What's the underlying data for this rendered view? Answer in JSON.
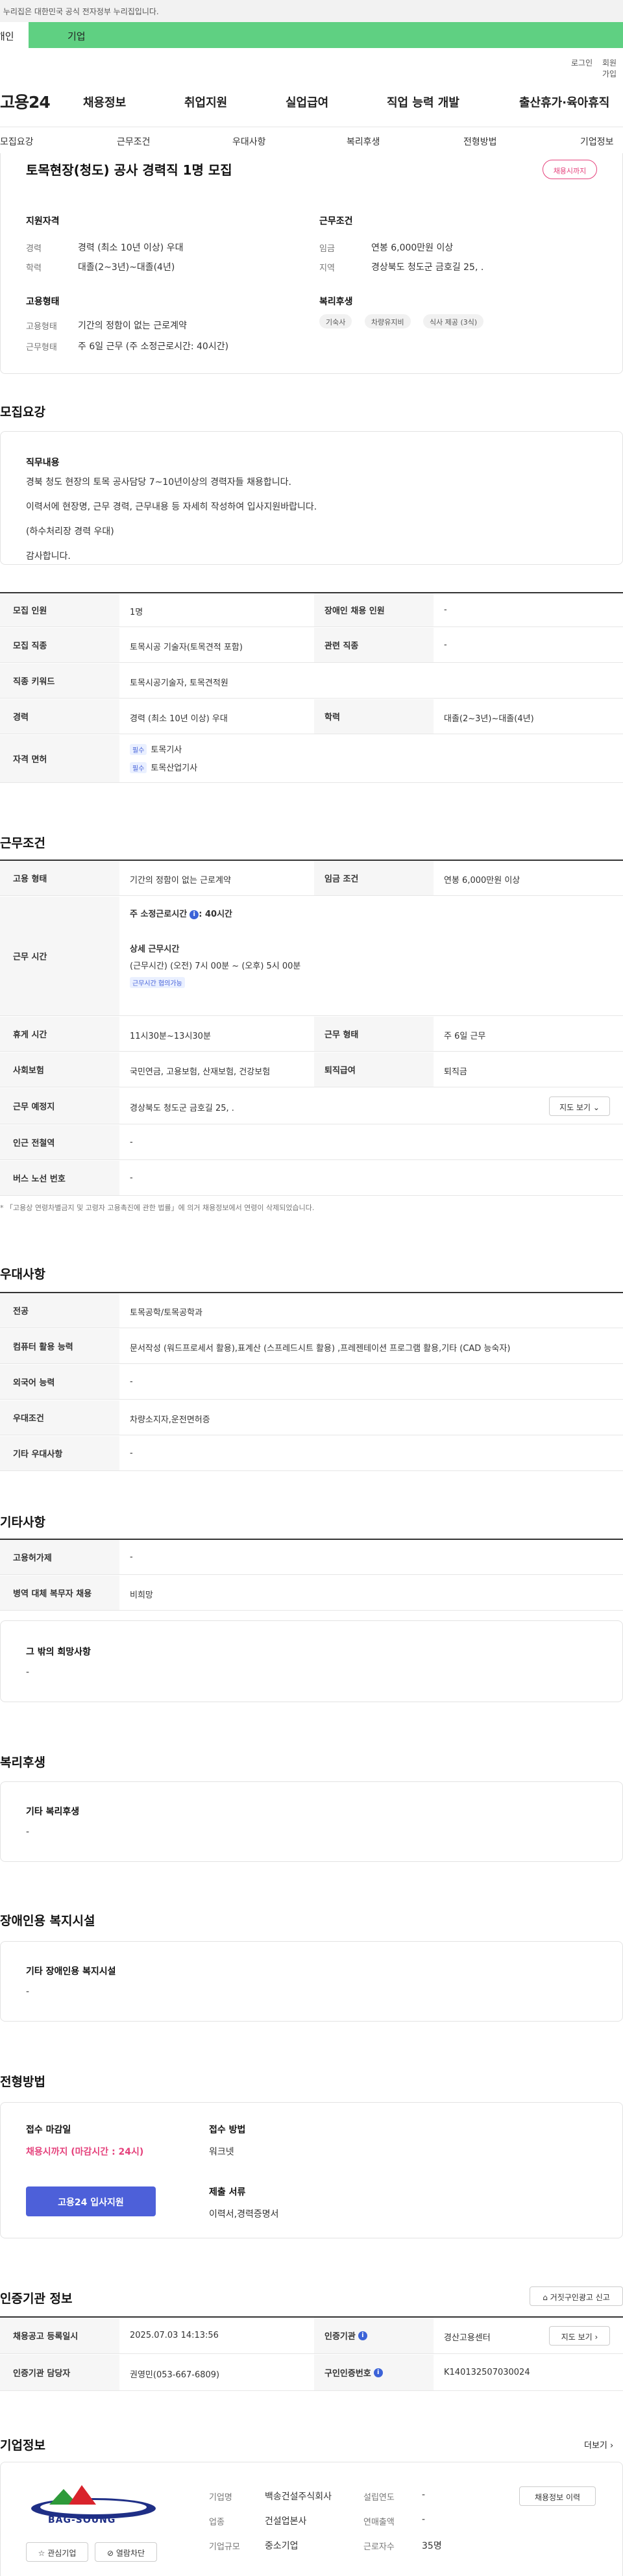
{
  "gov_banner": "이 누리집은 대한민국 공식 전자정부 누리집입니다.",
  "user_tabs": [
    "개인",
    "기업"
  ],
  "util_links": [
    "로그인",
    "회원가입"
  ],
  "logo": "고용24",
  "gnb": [
    "채용정보",
    "취업지원",
    "실업급여",
    "직업 능력 개발",
    "출산휴가·육아휴직"
  ],
  "anchor_nav": [
    "모집요강",
    "근무조건",
    "우대사항",
    "복리후생",
    "전형방법",
    "기업정보"
  ],
  "summary": {
    "title": "토목현장(청도) 공사 경력직 1명 모집",
    "badge": "채용시까지",
    "qualification_head": "지원자격",
    "career_label": "경력",
    "career": "경력 (최소 10년 이상) 우대",
    "edu_label": "학력",
    "edu": "대졸(2~3년)~대졸(4년)",
    "conditions_head": "근무조건",
    "wage_label": "임금",
    "wage": "연봉 6,000만원 이상",
    "region_label": "지역",
    "region": "경상북도 청도군 금호길 25, .",
    "employment_head": "고용형태",
    "emp_type_label": "고용형태",
    "emp_type": "기간의 정함이 없는 근로계약",
    "work_type_label": "근무형태",
    "work_type": "주 6일 근무 (주 소정근로시간: 40시간)",
    "welfare_head": "복리후생",
    "welfare_chips": [
      "기숙사",
      "차량유지비",
      "식사 제공 (3식)"
    ]
  },
  "recruit": {
    "title": "모집요강",
    "duties_title": "직무내용",
    "duties": [
      "경북 청도 현장의 토목 공사담당 7~10년이상의 경력자들 채용합니다.",
      "이력서에 현장명, 근무 경력, 근무내용 등 자세히 작성하여 입사지원바랍니다.",
      "(하수처리장 경력 우대)",
      "감사합니다."
    ],
    "rows": {
      "count_label": "모집 인원",
      "count": "1명",
      "disabled_label": "장애인 채용 인원",
      "disabled": "-",
      "job_label": "모집 직종",
      "job": "토목시공 기술자(토목견적 포함)",
      "related_label": "관련 직종",
      "related": "-",
      "keyword_label": "직종 키워드",
      "keyword": "토목시공기술자, 토목견적원",
      "career_label": "경력",
      "career": "경력 (최소 10년 이상) 우대",
      "edu_label": "학력",
      "edu": "대졸(2~3년)~대졸(4년)",
      "license_label": "자격 면허",
      "license_tag": "필수",
      "licenses": [
        "토목기사",
        "토목산업기사"
      ]
    }
  },
  "conditions": {
    "title": "근무조건",
    "emp_label": "고용 형태",
    "emp": "기간의 정함이 없는 근로계약",
    "wage_label": "임금 조건",
    "wage": "연봉 6,000만원 이상",
    "hours_label": "근무 시간",
    "hours_week_label": "주 소정근로시간",
    "hours_week": ": 40시간",
    "hours_detail_label": "상세 근무시간",
    "hours_detail": "(근무시간) (오전) 7시 00분 ~ (오후) 5시 00분",
    "hours_tag": "근무시간 협의가능",
    "break_label": "휴게 시간",
    "break": "11시30분~13시30분",
    "worktype_label": "근무 형태",
    "worktype": "주 6일 근무",
    "insurance_label": "사회보험",
    "insurance": "국민연금, 고용보험, 산재보험, 건강보험",
    "retire_label": "퇴직급여",
    "retire": "퇴직금",
    "place_label": "근무 예정지",
    "place": "경상북도 청도군 금호길 25, .",
    "map_btn": "지도 보기",
    "subway_label": "인근 전철역",
    "subway": "-",
    "bus_label": "버스 노선 번호",
    "bus": "-",
    "note": "* 「고용상 연령차별금지 및 고령자 고용촉진에 관한 법률」에 의거 채용정보에서 연령이 삭제되었습니다."
  },
  "preference": {
    "title": "우대사항",
    "major_label": "전공",
    "major": "토목공학/토목공학과",
    "computer_label": "컴퓨터 활용 능력",
    "computer": "문서작성 (워드프로세서 활용),표계산 (스프레드시트 활용) ,프레젠테이션 프로그램 활용,기타 (CAD 능숙자)",
    "lang_label": "외국어 능력",
    "lang": "-",
    "cond_label": "우대조건",
    "cond": "차량소지자,운전면허증",
    "etc_label": "기타 우대사항",
    "etc": "-"
  },
  "other": {
    "title": "기타사항",
    "disabled_label": "고용허가제",
    "disabled": "-",
    "military_label": "병역 대체 복무자 채용",
    "military": "비희망",
    "wish_title": "그 밖의 희망사항",
    "wish": "-"
  },
  "welfare": {
    "title": "복리후생",
    "box_title": "기타 복리후생",
    "box_text": "-"
  },
  "facility": {
    "title": "장애인용 복지시설",
    "box_title": "기타 장애인용 복지시설",
    "box_text": "-"
  },
  "selection": {
    "title": "전형방법",
    "deadline_label": "접수 마감일",
    "deadline": "채용시까지 (마감시간 : 24시)",
    "apply_btn": "고용24 입사지원",
    "method_label": "접수 방법",
    "method": "워크넷",
    "docs_label": "제출 서류",
    "docs": "이력서,경력증명서"
  },
  "agency": {
    "title": "인증기관 정보",
    "report_btn": "거짓구인광고 신고",
    "date_label": "채용공고 등록일시",
    "date": "2025.07.03 14:13:56",
    "org_label": "인증기관",
    "org": "경산고용센터",
    "map_btn": "지도 보기",
    "manager_label": "인증기관 담당자",
    "manager": "권영민(053-667-6809)",
    "auth_label": "구인인증번호",
    "auth": "K140132507030024"
  },
  "company": {
    "title": "기업정보",
    "more": "더보기",
    "logo_text": "BAG-SOUNG",
    "name_label": "기업명",
    "name": "백송건설주식회사",
    "year_label": "설립연도",
    "year": "-",
    "industry_label": "업종",
    "industry": "건설업본사",
    "sales_label": "연매출액",
    "sales": "-",
    "size_label": "기업규모",
    "size": "중소기업",
    "staff_label": "근로자수",
    "staff": "35명",
    "list_btn": "채용정보 이력",
    "fav_btn": "관심기업",
    "block_btn": "열람차단"
  },
  "colors": {
    "accent_green": "#5fd082",
    "badge_pink": "#e5427c",
    "primary_blue": "#4d60d9"
  }
}
